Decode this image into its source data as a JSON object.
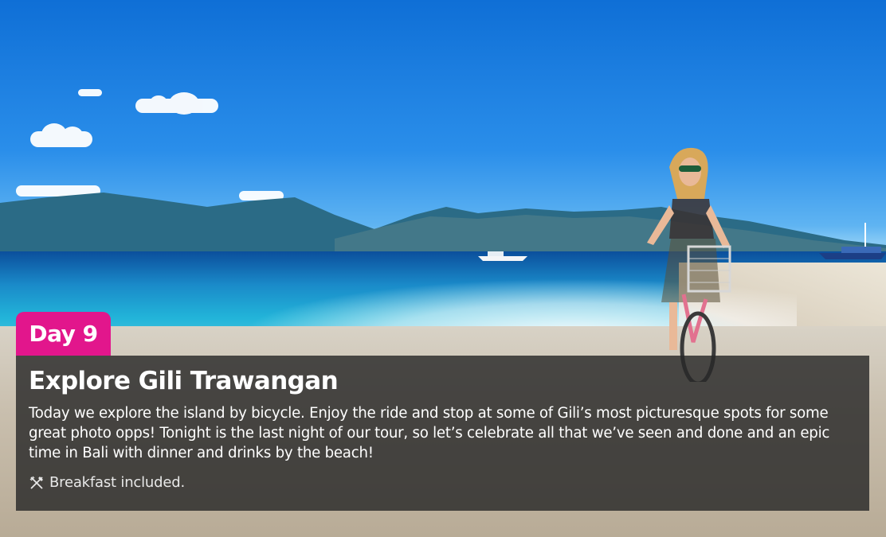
{
  "itinerary": {
    "day_label": "Day 9",
    "title": "Explore Gili Trawangan",
    "description": "Today we explore the island by bicycle. Enjoy the ride and stop at some of Gili’s most picturesque spots for some great photo opps! Tonight is the last night of our tour, so let’s celebrate all that we’ve seen and done and an epic time in Bali with dinner and drinks by the beach!",
    "meals": {
      "icon": "utensils-icon",
      "text": "Breakfast included."
    }
  },
  "colors": {
    "badge": "#e2168c",
    "panel_overlay": "#282828"
  }
}
